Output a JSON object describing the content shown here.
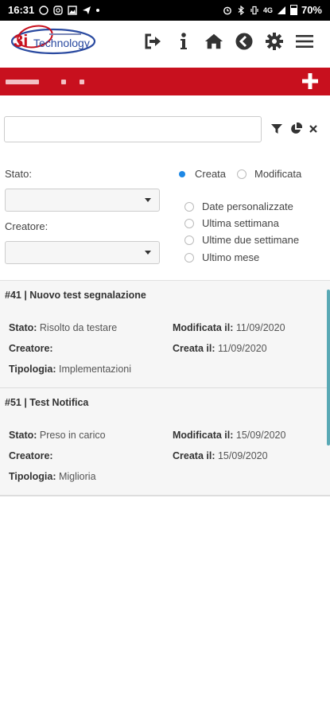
{
  "statusbar": {
    "time": "16:31",
    "network": "4G",
    "battery": "70%"
  },
  "header": {
    "logo_text": "Technology",
    "logo_prefix": "3i",
    "icons": [
      "sign-out-icon",
      "info-icon",
      "home-icon",
      "back-icon",
      "gear-icon",
      "menu-icon"
    ]
  },
  "colors": {
    "brand_red": "#c8101e",
    "accent_blue": "#1e88e5",
    "scrollbar": "#5aa9b5"
  },
  "search": {
    "value": "",
    "placeholder": ""
  },
  "filters": {
    "stato_label": "Stato:",
    "creatore_label": "Creatore:",
    "stato_value": "",
    "creatore_value": "",
    "date_mode": [
      {
        "label": "Creata",
        "selected": true
      },
      {
        "label": "Modificata",
        "selected": false
      }
    ],
    "ranges": [
      {
        "label": "Date personalizzate",
        "selected": false
      },
      {
        "label": "Ultima settimana",
        "selected": false
      },
      {
        "label": "Ultime due settimane",
        "selected": false
      },
      {
        "label": "Ultimo mese",
        "selected": false
      }
    ]
  },
  "list": [
    {
      "title": "#41 | Nuovo test segnalazione",
      "stato_label": "Stato:",
      "stato": "Risolto da testare",
      "creatore_label": "Creatore:",
      "creatore": "",
      "tipologia_label": "Tipologia:",
      "tipologia": "Implementazioni",
      "modificata_label": "Modificata il:",
      "modificata": "11/09/2020",
      "creata_label": "Creata il:",
      "creata": "11/09/2020"
    },
    {
      "title": "#51 | Test Notifica",
      "stato_label": "Stato:",
      "stato": "Preso in carico",
      "creatore_label": "Creatore:",
      "creatore": "",
      "tipologia_label": "Tipologia:",
      "tipologia": "Miglioria",
      "modificata_label": "Modificata il:",
      "modificata": "15/09/2020",
      "creata_label": "Creata il:",
      "creata": "15/09/2020"
    }
  ]
}
